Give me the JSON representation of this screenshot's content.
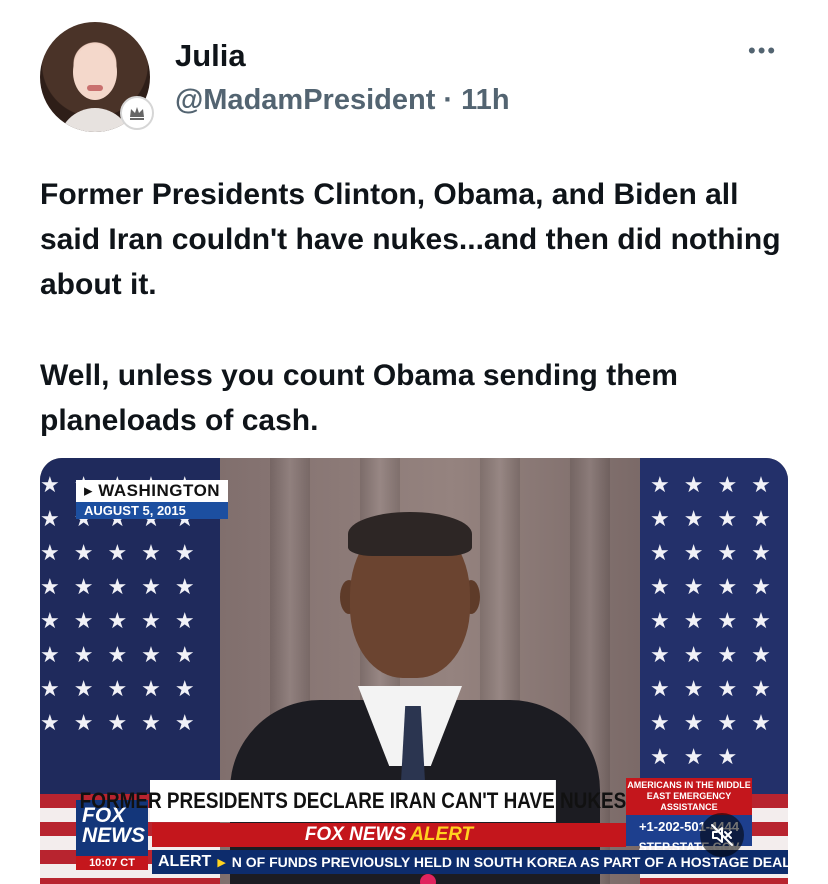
{
  "user": {
    "name": "Julia",
    "handle": "@MadamPresident",
    "separator": "·",
    "time": "11h",
    "more_label": "•••"
  },
  "tweet": {
    "paragraph1": "Former Presidents Clinton, Obama, and Biden all said Iran couldn't have nukes...and then did nothing about it.",
    "paragraph2": "Well, unless you count Obama sending them planeloads of cash."
  },
  "video": {
    "dateline_place": "WASHINGTON",
    "dateline_date": "AUGUST 5, 2015",
    "chyron": "FORMER PRESIDENTS DECLARE IRAN CAN'T HAVE NUKES",
    "alert_brand": "FOX NEWS",
    "alert_word": "ALERT",
    "network_logo_line1": "FOX",
    "network_logo_line2": "NEWS",
    "clock": "10:07 CT",
    "phone_title": "AMERICANS IN THE MIDDLE EAST EMERGENCY ASSISTANCE",
    "phone_number": "+1-202-501-4444",
    "phone_footer": "STEP.STATE.GOV",
    "ticker_label": "ALERT",
    "ticker_text": "N OF FUNDS PREVIOUSLY HELD IN SOUTH KOREA AS PART OF A HOSTAGE DEAL",
    "muted": true
  }
}
